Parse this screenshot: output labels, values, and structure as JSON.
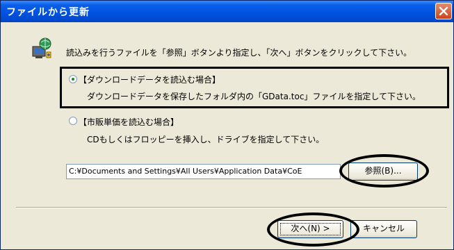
{
  "window": {
    "title": "ファイルから更新"
  },
  "instruction": "読込みを行うファイルを「参照」ボタンより指定し、「次へ」ボタンをクリックして下さい。",
  "options": [
    {
      "label": "【ダウンロードデータを読込む場合】",
      "detail": "ダウンロードデータを保存したフォルダ内の「GData.toc」ファイルを指定して下さい。",
      "selected": true
    },
    {
      "label": "【市販単価を読込む場合】",
      "detail": "CDもしくはフロッピーを挿入し、ドライブを指定して下さい。",
      "selected": false
    }
  ],
  "path_value": "C:¥Documents and Settings¥All Users¥Application Data¥CoE",
  "buttons": {
    "browse": "参照(B)...",
    "next": "次へ(N) >",
    "cancel": "キャンセル"
  },
  "icons": {
    "close": "close-icon",
    "app": "globe-computer-icon"
  },
  "colors": {
    "titlebar": "#0053e1",
    "dialog": "#ece9d8",
    "close": "#c9441b",
    "radio_dot": "#1b8a1b"
  }
}
